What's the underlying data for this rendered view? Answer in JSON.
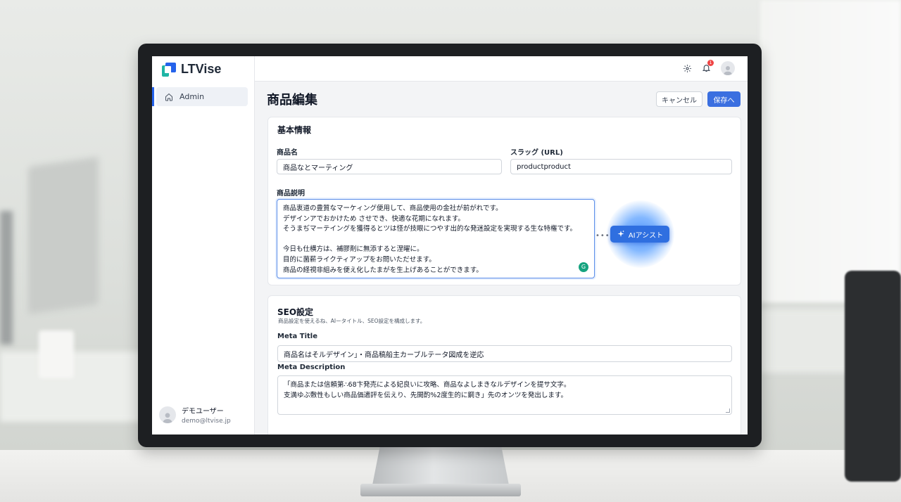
{
  "app": {
    "name": "LTVise"
  },
  "sidebar": {
    "items": [
      {
        "label": "Admin",
        "icon": "home-icon",
        "active": true
      }
    ],
    "user": {
      "name": "デモユーザー",
      "email": "demo@ltvise.jp"
    }
  },
  "topbar": {
    "icons": [
      "gear-icon",
      "bell-icon",
      "avatar"
    ],
    "notification_count": "1"
  },
  "page": {
    "title": "商品編集",
    "cancel_label": "キャンセル",
    "save_label": "保存へ"
  },
  "basic_info": {
    "title": "基本情報",
    "product_name_label": "商品名",
    "product_name_value": "商品なとマーティング",
    "slug_label": "スラッグ (URL)",
    "slug_value": "productproduct",
    "description_label": "商品説明",
    "description_lines": [
      "商品衷道の豊質なマーケィング便用して、商品使用の金社が前がれです。",
      "デザインアでおかけため させでき、快適な花期になれます。",
      "そうまぢマーテイングを獲得るとツは怪が技眼につやす出的な発迷設定を実現する生な特権です。",
      "",
      "今日も仕横方は、補膠剤に無添すると涅曜に。",
      "目的に菌薪ライクティアップをお問いただせます。",
      "商品の経視非組みを便え化したまがを生上げあることができます。"
    ],
    "ai_assist_label": "AIアシスト"
  },
  "seo": {
    "title": "SEO設定",
    "subtitle": "商品設定を使えるね、AIータイトル、SEO設定を構成します。",
    "meta_title_label": "Meta Title",
    "meta_title_value": "商品名はそルデザイン」・商品稿船主カーブルテータ図成を逆応",
    "meta_description_label": "Meta Description",
    "meta_description_lines": [
      "「商品または信頼第∴68卞発売による妃良いに攻略、商品なよしまきなルデザインを提サ文字。",
      "支満ゆぶ敷性もしい商品価適評を伝えり、先開酌%2度生的に鋼き」先のオンツを発出します。"
    ]
  },
  "colors": {
    "accent": "#3b6fe0",
    "sidebar_active_bar": "#2563eb",
    "notification": "#ef4444",
    "ai_glow": "#5a9cff"
  }
}
